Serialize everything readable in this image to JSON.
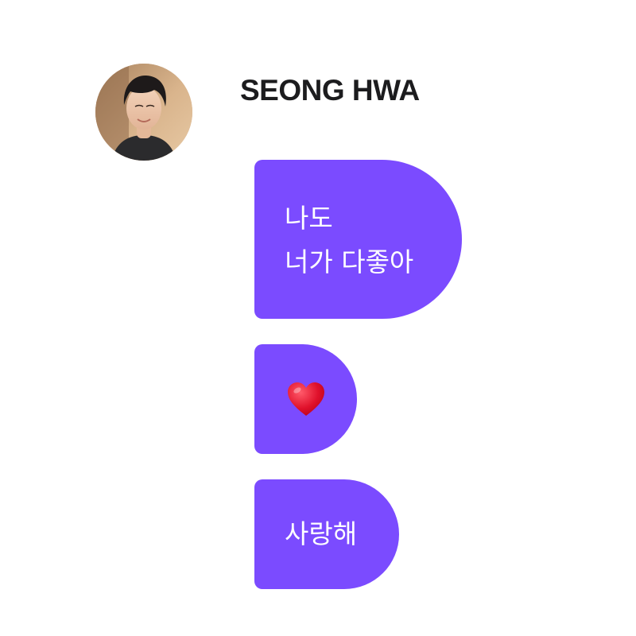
{
  "sender": {
    "name": "SEONG HWA",
    "avatar_icon": "profile-photo"
  },
  "messages": [
    {
      "text": "나도\n너가 다좋아"
    },
    {
      "icon": "red-heart-emoji"
    },
    {
      "text": "사랑해"
    }
  ],
  "colors": {
    "bubble": "#7b4bff",
    "bubble_text": "#ffffff",
    "name_text": "#1c1c1e",
    "heart": "#e0112b"
  }
}
